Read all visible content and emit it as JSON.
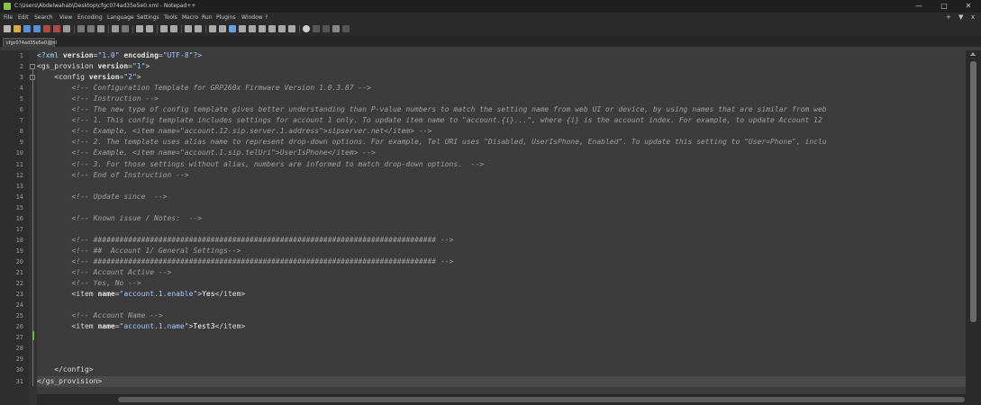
{
  "window": {
    "title": "C:\\Users\\Abdelwahab\\Desktop\\cfgc074ad35e5e0.xml - Notepad++",
    "minimize": "—",
    "maximize": "□",
    "close": "✕"
  },
  "menu": {
    "items": [
      "File",
      "Edit",
      "Search",
      "View",
      "Encoding",
      "Language",
      "Settings",
      "Tools",
      "Macro",
      "Run",
      "Plugins",
      "Window",
      "?"
    ],
    "right": [
      "+",
      "▼",
      "x"
    ]
  },
  "tab": {
    "label": "cfgc074ad35e5e0.xml"
  },
  "editor": {
    "lines": [
      {
        "n": "1",
        "tokens": [
          {
            "c": "pi",
            "t": "<?xml "
          },
          {
            "c": "attr",
            "t": "version"
          },
          {
            "c": "tag",
            "t": "="
          },
          {
            "c": "val",
            "t": "\"1.0\""
          },
          {
            "c": "tag",
            "t": " "
          },
          {
            "c": "attr",
            "t": "encoding"
          },
          {
            "c": "tag",
            "t": "="
          },
          {
            "c": "val",
            "t": "\"UTF-8\""
          },
          {
            "c": "pi",
            "t": "?>"
          }
        ]
      },
      {
        "n": "2",
        "tokens": [
          {
            "c": "tag",
            "t": "<gs_provision "
          },
          {
            "c": "attr",
            "t": "version"
          },
          {
            "c": "tag",
            "t": "="
          },
          {
            "c": "val",
            "t": "\"1\""
          },
          {
            "c": "tag",
            "t": ">"
          }
        ]
      },
      {
        "n": "3",
        "tokens": [
          {
            "c": "tag",
            "t": "    <config "
          },
          {
            "c": "attr",
            "t": "version"
          },
          {
            "c": "tag",
            "t": "="
          },
          {
            "c": "val",
            "t": "\"2\""
          },
          {
            "c": "tag",
            "t": ">"
          }
        ]
      },
      {
        "n": "4",
        "tokens": [
          {
            "c": "com",
            "t": "        <!-- Configuration Template for GRP260x Firmware Version 1.0.3.87 -->"
          }
        ]
      },
      {
        "n": "5",
        "tokens": [
          {
            "c": "com",
            "t": "        <!-- Instruction -->"
          }
        ]
      },
      {
        "n": "6",
        "tokens": [
          {
            "c": "com",
            "t": "        <!-- The new type of config template gives better understanding than P-value numbers to match the setting name from web UI or device, by using names that are similar from web"
          }
        ]
      },
      {
        "n": "7",
        "tokens": [
          {
            "c": "com",
            "t": "        <!-- 1. This config template includes settings for account 1 only. To update item name to \"account.{i}...\", where {i} is the account index. For example, to update Account 12"
          }
        ]
      },
      {
        "n": "8",
        "tokens": [
          {
            "c": "com",
            "t": "        <!-- Example, <item name=\"account.12.sip.server.1.address\">sipserver.net</item> -->"
          }
        ]
      },
      {
        "n": "9",
        "tokens": [
          {
            "c": "com",
            "t": "        <!-- 2. The template uses alias name to represent drop-down options. For example, Tel URI uses \"Disabled, UserIsPhone, Enabled\". To update this setting to \"User=Phone\", inclu"
          }
        ]
      },
      {
        "n": "10",
        "tokens": [
          {
            "c": "com",
            "t": "        <!-- Example, <item name=\"account.1.sip.telUri\">UserIsPhone</item> -->"
          }
        ]
      },
      {
        "n": "11",
        "tokens": [
          {
            "c": "com",
            "t": "        <!-- 3. For those settings without alias, numbers are informed to match drop-down options.  -->"
          }
        ]
      },
      {
        "n": "12",
        "tokens": [
          {
            "c": "com",
            "t": "        <!-- End of Instruction -->"
          }
        ]
      },
      {
        "n": "13",
        "tokens": []
      },
      {
        "n": "14",
        "tokens": [
          {
            "c": "com",
            "t": "        <!-- Update since  -->"
          }
        ]
      },
      {
        "n": "15",
        "tokens": []
      },
      {
        "n": "16",
        "tokens": [
          {
            "c": "com",
            "t": "        <!-- Known issue / Notes:  -->"
          }
        ]
      },
      {
        "n": "17",
        "tokens": []
      },
      {
        "n": "18",
        "tokens": [
          {
            "c": "com",
            "t": "        <!-- ############################################################################### -->"
          }
        ]
      },
      {
        "n": "19",
        "tokens": [
          {
            "c": "com",
            "t": "        <!-- ##  Account 1/ General Settings-->"
          }
        ]
      },
      {
        "n": "20",
        "tokens": [
          {
            "c": "com",
            "t": "        <!-- ############################################################################### -->"
          }
        ]
      },
      {
        "n": "21",
        "tokens": [
          {
            "c": "com",
            "t": "        <!-- Account Active -->"
          }
        ]
      },
      {
        "n": "22",
        "tokens": [
          {
            "c": "com",
            "t": "        <!-- Yes, No -->"
          }
        ]
      },
      {
        "n": "23",
        "tokens": [
          {
            "c": "tag",
            "t": "        <item "
          },
          {
            "c": "attr",
            "t": "name"
          },
          {
            "c": "tag",
            "t": "="
          },
          {
            "c": "val",
            "t": "\"account.1.enable\""
          },
          {
            "c": "tag",
            "t": ">"
          },
          {
            "c": "txt",
            "t": "Yes"
          },
          {
            "c": "tag",
            "t": "</item>"
          }
        ]
      },
      {
        "n": "24",
        "tokens": []
      },
      {
        "n": "25",
        "tokens": [
          {
            "c": "com",
            "t": "        <!-- Account Name -->"
          }
        ]
      },
      {
        "n": "26",
        "tokens": [
          {
            "c": "tag",
            "t": "        <item "
          },
          {
            "c": "attr",
            "t": "name"
          },
          {
            "c": "tag",
            "t": "="
          },
          {
            "c": "val",
            "t": "\"account.1.name\""
          },
          {
            "c": "tag",
            "t": ">"
          },
          {
            "c": "txt",
            "t": "Test3"
          },
          {
            "c": "tag",
            "t": "</item>"
          }
        ]
      },
      {
        "n": "27",
        "tokens": []
      },
      {
        "n": "28",
        "tokens": []
      },
      {
        "n": "29",
        "tokens": []
      },
      {
        "n": "30",
        "tokens": [
          {
            "c": "tag",
            "t": "    </config>"
          }
        ]
      },
      {
        "n": "31",
        "tokens": [
          {
            "c": "tag",
            "t": "</gs_provision>"
          }
        ]
      }
    ]
  },
  "colors": {
    "comment": "#a0a0a0",
    "attribute_value": "#a8c8ff",
    "change_marker": "#5fbf3f"
  }
}
